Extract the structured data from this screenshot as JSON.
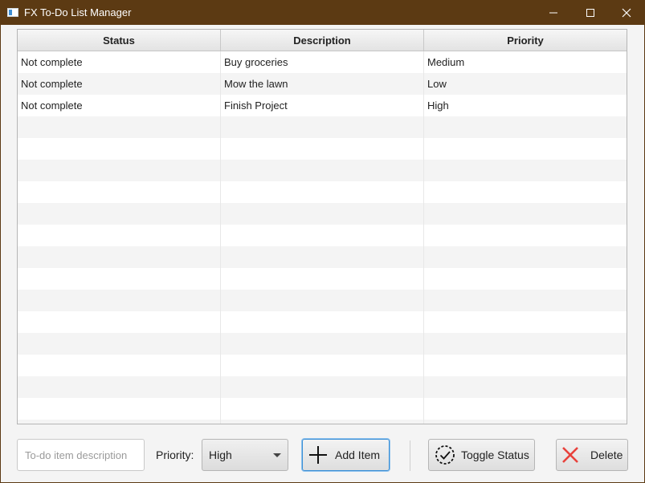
{
  "window": {
    "title": "FX To-Do List Manager",
    "icons": {
      "app": "app-icon",
      "minimize": "minimize-icon",
      "maximize": "maximize-icon",
      "close": "close-icon"
    }
  },
  "table": {
    "columns": [
      "Status",
      "Description",
      "Priority"
    ],
    "rows": [
      [
        "Not complete",
        "Buy groceries",
        "Medium"
      ],
      [
        "Not complete",
        "Mow the lawn",
        "Low"
      ],
      [
        "Not complete",
        "Finish Project",
        "High"
      ]
    ]
  },
  "controls": {
    "description_placeholder": "To-do item description",
    "description_value": "",
    "priority_label": "Priority:",
    "priority_selected": "High",
    "add_label": "Add Item",
    "toggle_label": "Toggle Status",
    "delete_label": "Delete",
    "icons": {
      "add": "plus-icon",
      "toggle": "check-circle-icon",
      "delete": "x-icon"
    }
  },
  "colors": {
    "titlebar": "#5c3a13",
    "delete_icon": "#e8413b",
    "focus_border": "#3a8fd6"
  }
}
